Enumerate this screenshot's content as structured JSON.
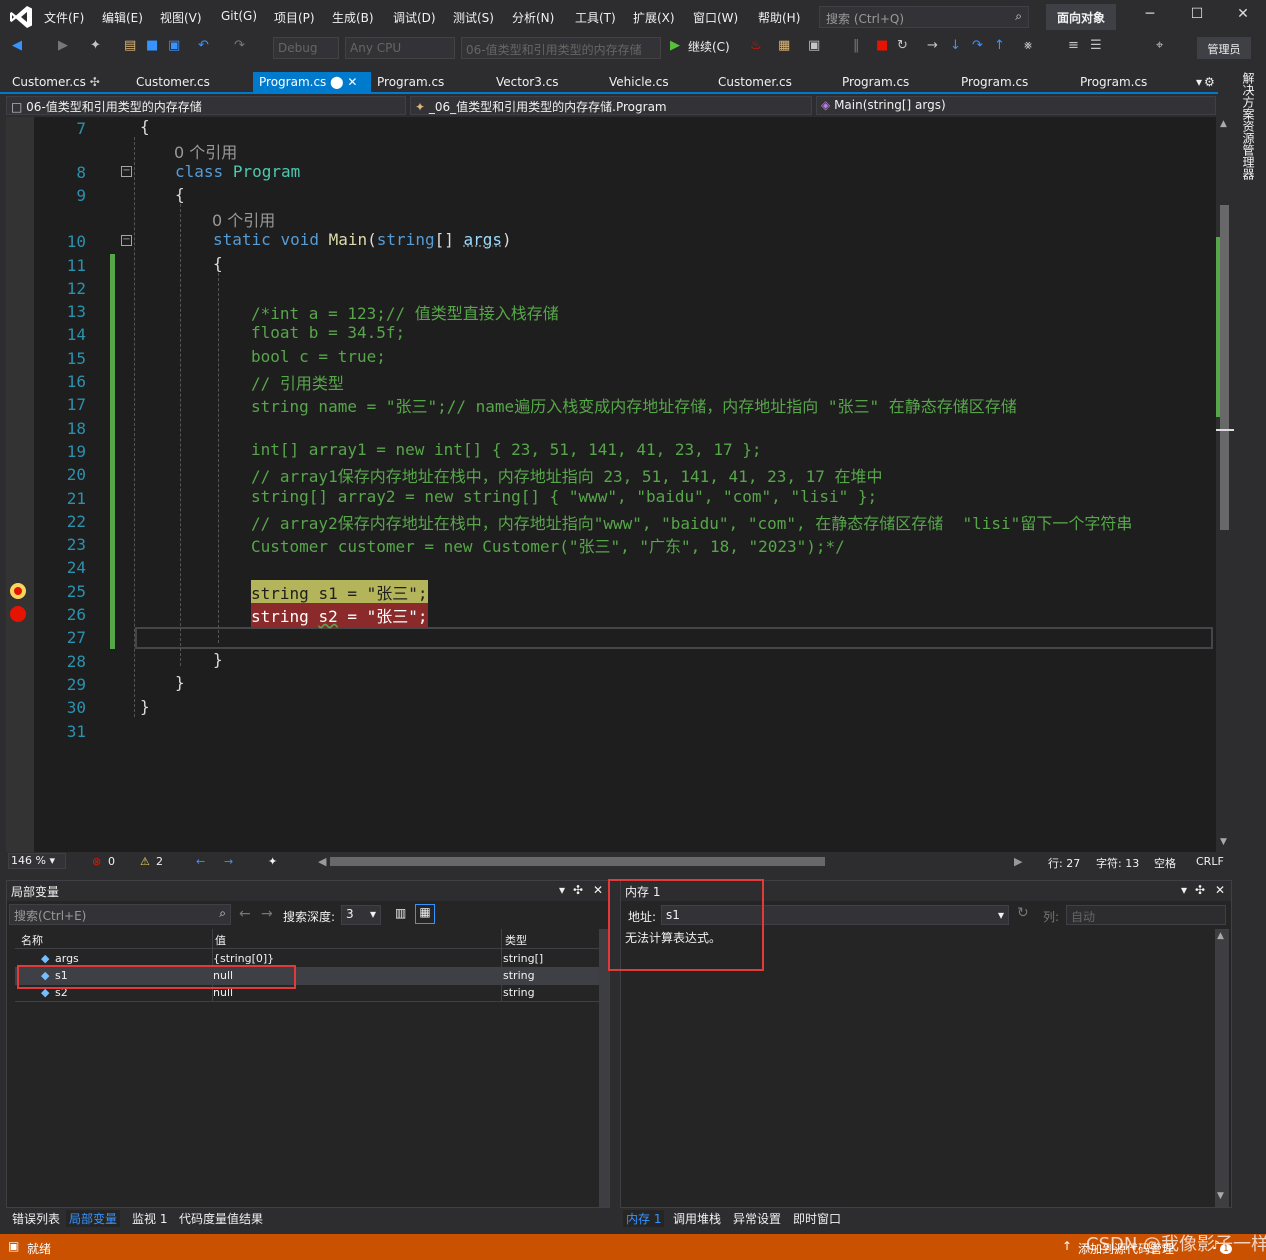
{
  "menu": [
    "文件(F)",
    "编辑(E)",
    "视图(V)",
    "Git(G)",
    "项目(P)",
    "生成(B)",
    "调试(D)",
    "测试(S)",
    "分析(N)",
    "工具(T)",
    "扩展(X)",
    "窗口(W)",
    "帮助(H)"
  ],
  "search": {
    "placeholder": "搜索 (Ctrl+Q)"
  },
  "title_badge": "面向对象",
  "toolbar": {
    "config": "Debug",
    "platform": "Any CPU",
    "startup": "06-值类型和引用类型的内存存储",
    "continue": "继续(C)",
    "admin": "管理员"
  },
  "tabs": [
    {
      "label": "Customer.cs",
      "pin": "ꟷ"
    },
    {
      "label": "Customer.cs"
    },
    {
      "label": "Program.cs",
      "active": true
    },
    {
      "label": "Program.cs"
    },
    {
      "label": "Vector3.cs"
    },
    {
      "label": "Vehicle.cs"
    },
    {
      "label": "Customer.cs"
    },
    {
      "label": "Program.cs"
    },
    {
      "label": "Program.cs"
    },
    {
      "label": "Program.cs"
    }
  ],
  "nav": {
    "project": "06-值类型和引用类型的内存存储",
    "class": "_06_值类型和引用类型的内存存储.Program",
    "member": "Main(string[] args)"
  },
  "solution_explorer": "解决方案资源管理器",
  "code": {
    "refs": "0 个引用",
    "line_numbers": [
      "7",
      "8",
      "9",
      "10",
      "11",
      "12",
      "13",
      "14",
      "15",
      "16",
      "17",
      "18",
      "19",
      "20",
      "21",
      "22",
      "23",
      "24",
      "25",
      "26",
      "27",
      "28",
      "29",
      "30",
      "31"
    ],
    "lines": {
      "l7": "{",
      "l8_kw": "class",
      "l8_ty": "Program",
      "l9": "{",
      "l10_kw1": "static",
      "l10_kw2": "void",
      "l10_fn": "Main",
      "l10_kw3": "string",
      "l10_pa": "args",
      "l11": "{",
      "l13": "/*int a = 123;// 值类型直接入栈存储",
      "l14": "float b = 34.5f;",
      "l15": "bool c = true;",
      "l16": "// 引用类型",
      "l17": "string name = \"张三\";// name遍历入栈变成内存地址存储，内存地址指向 \"张三\" 在静态存储区存储",
      "l19": "int[] array1 = new int[] { 23, 51, 141, 41, 23, 17 };",
      "l20": "// array1保存内存地址在栈中，内存地址指向 23, 51, 141, 41, 23, 17 在堆中",
      "l21": "string[] array2 = new string[] { \"www\", \"baidu\", \"com\", \"lisi\" };",
      "l22": "// array2保存内存地址在栈中，内存地址指向\"www\", \"baidu\", \"com\", 在静态存储区存储  \"lisi\"留下一个字符串",
      "l23": "Customer customer = new Customer(\"张三\", \"广东\", 18, \"2023\");*/",
      "l25_kw": "string",
      "l25_var": "s1",
      "l25_str": "\"张三\"",
      "l26_kw": "string",
      "l26_var": "s2",
      "l26_str": "\"张三\"",
      "l28": "}",
      "l29": "}",
      "l30": "}"
    }
  },
  "editor_status": {
    "zoom": "146 %",
    "errors": "0",
    "warnings": "2",
    "line": "行: 27",
    "char": "字符: 13",
    "space": "空格",
    "eol": "CRLF"
  },
  "locals": {
    "title": "局部变量",
    "search_placeholder": "搜索(Ctrl+E)",
    "depth_label": "搜索深度:",
    "depth": "3",
    "headers": [
      "名称",
      "值",
      "类型"
    ],
    "rows": [
      {
        "name": "args",
        "value": "{string[0]}",
        "type": "string[]"
      },
      {
        "name": "s1",
        "value": "null",
        "type": "string"
      },
      {
        "name": "s2",
        "value": "null",
        "type": "string"
      }
    ]
  },
  "memory": {
    "title": "内存 1",
    "address_label": "地址:",
    "address": "s1",
    "column_label": "列:",
    "column": "自动",
    "message": "无法计算表达式。"
  },
  "bottom_tabs_left": [
    "错误列表",
    "局部变量",
    "监视 1",
    "代码度量值结果"
  ],
  "bottom_tabs_right": [
    "内存 1",
    "调用堆栈",
    "异常设置",
    "即时窗口"
  ],
  "status": {
    "ready": "就绪",
    "source_control": "添加到源代码管理",
    "notification_count": "1"
  },
  "watermark": "CSDN @我像影子一样",
  "colors": {
    "accent": "#007acc",
    "status": "#ca5100",
    "breakpoint": "#e51400",
    "highlight_box": "#e23a3a"
  }
}
